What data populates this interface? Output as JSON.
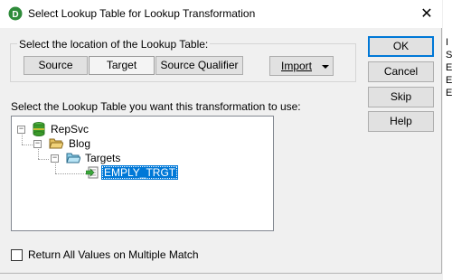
{
  "window": {
    "title": "Select Lookup Table for Lookup Transformation",
    "close_glyph": "✕",
    "app_icon_letter": "D"
  },
  "location_group": {
    "legend": "Select the location of the Lookup Table:",
    "tabs": [
      "Source",
      "Target",
      "Source Qualifier"
    ],
    "selected_tab": "Target",
    "import_label": "Import"
  },
  "buttons": {
    "ok": "OK",
    "cancel": "Cancel",
    "skip": "Skip",
    "help": "Help"
  },
  "prompt": "Select the Lookup Table you want this transformation to use:",
  "tree": {
    "repository": "RepSvc",
    "folder": "Blog",
    "group": "Targets",
    "item": "EMPLY_TRGT",
    "expander_glyph": "−"
  },
  "checkbox": {
    "label": "Return All Values on Multiple Match",
    "checked": false
  },
  "background_window_letters": [
    "I",
    "S",
    "E",
    "E",
    "E"
  ],
  "colors": {
    "selection": "#0078d7",
    "repository_icon": "#3a9a2a",
    "folder_icon": "#c9a24a",
    "target_icon": "#4aa3c9"
  }
}
